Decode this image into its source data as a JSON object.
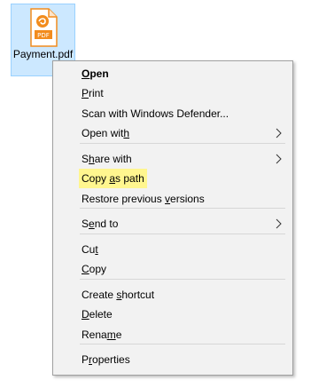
{
  "file": {
    "name": "Payment.pdf",
    "icon": "pdf-file-icon",
    "icon_badge": "PDF",
    "accent_color": "#f28c1d"
  },
  "context_menu": {
    "highlight_color": "#fff68f",
    "items": [
      {
        "label": "Open",
        "access_key_index": 0,
        "bold": true
      },
      {
        "label": "Print",
        "access_key_index": 0
      },
      {
        "label": "Scan with Windows Defender..."
      },
      {
        "label": "Open with",
        "access_key_index": 8,
        "submenu": true
      },
      {
        "label": "Share with",
        "access_key_index": 1,
        "submenu": true
      },
      {
        "label": "Copy as path",
        "access_key_index": 5,
        "highlighted": true
      },
      {
        "label": "Restore previous versions",
        "access_key_index": 17
      },
      {
        "label": "Send to",
        "access_key_index": 1,
        "submenu": true
      },
      {
        "label": "Cut",
        "access_key_index": 2
      },
      {
        "label": "Copy",
        "access_key_index": 0
      },
      {
        "label": "Create shortcut",
        "access_key_index": 7
      },
      {
        "label": "Delete",
        "access_key_index": 0
      },
      {
        "label": "Rename",
        "access_key_index": 4
      },
      {
        "label": "Properties",
        "access_key_index": 1
      }
    ]
  }
}
